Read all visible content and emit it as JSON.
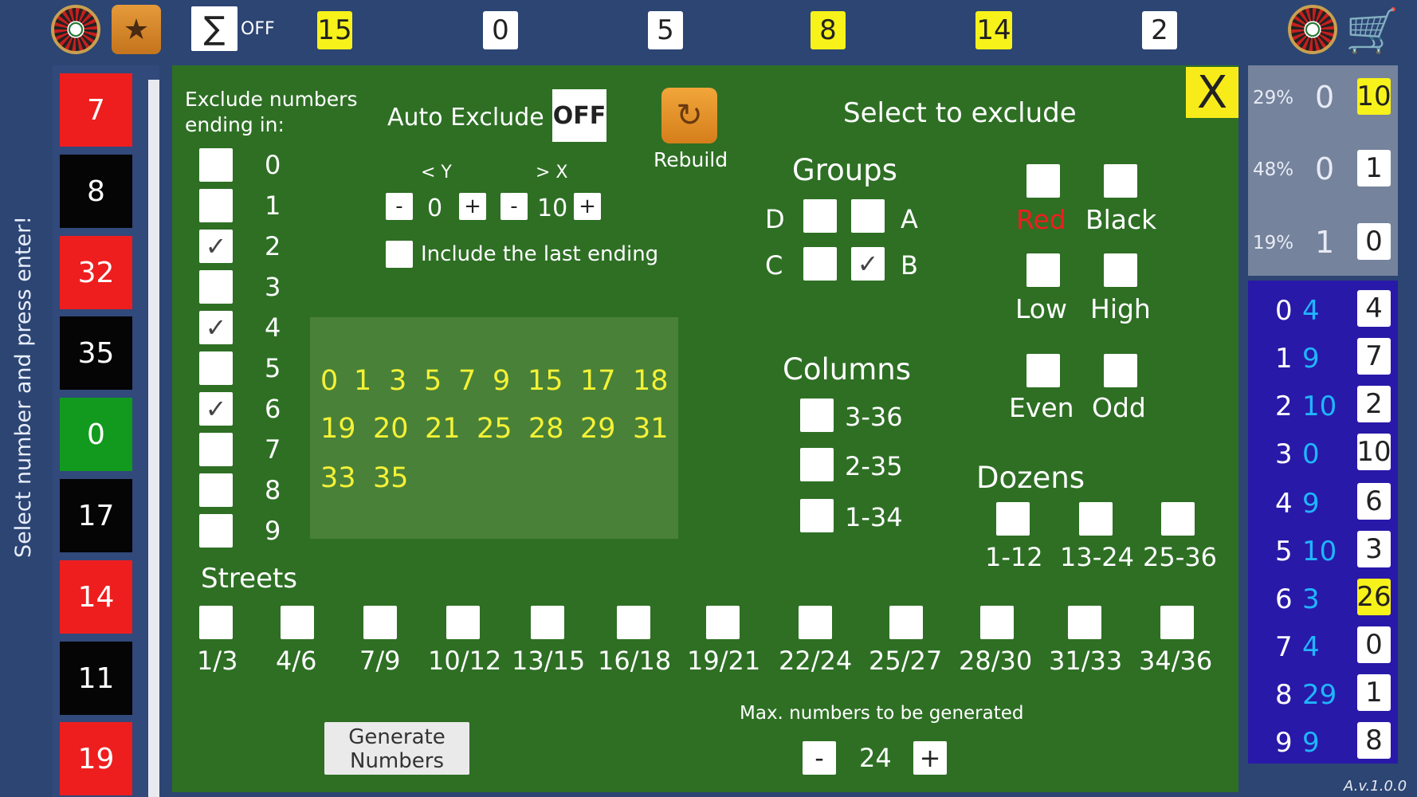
{
  "topbar": {
    "sigma_state": "OFF",
    "numbers": [
      {
        "value": "15",
        "color": "yellow"
      },
      {
        "value": "0",
        "color": "white"
      },
      {
        "value": "5",
        "color": "white"
      },
      {
        "value": "8",
        "color": "yellow"
      },
      {
        "value": "14",
        "color": "yellow"
      },
      {
        "value": "2",
        "color": "white"
      }
    ]
  },
  "sidebar_label": "Select number and press enter!",
  "history": [
    {
      "value": "7",
      "color": "red"
    },
    {
      "value": "8",
      "color": "black"
    },
    {
      "value": "32",
      "color": "red"
    },
    {
      "value": "35",
      "color": "black"
    },
    {
      "value": "0",
      "color": "green"
    },
    {
      "value": "17",
      "color": "black"
    },
    {
      "value": "14",
      "color": "red"
    },
    {
      "value": "11",
      "color": "black"
    },
    {
      "value": "19",
      "color": "red"
    }
  ],
  "panel": {
    "exclude_endings_title_1": "Exclude numbers",
    "exclude_endings_title_2": "ending in:",
    "endings": [
      {
        "digit": "0",
        "checked": false
      },
      {
        "digit": "1",
        "checked": false
      },
      {
        "digit": "2",
        "checked": true
      },
      {
        "digit": "3",
        "checked": false
      },
      {
        "digit": "4",
        "checked": true
      },
      {
        "digit": "5",
        "checked": false
      },
      {
        "digit": "6",
        "checked": true
      },
      {
        "digit": "7",
        "checked": false
      },
      {
        "digit": "8",
        "checked": false
      },
      {
        "digit": "9",
        "checked": false
      }
    ],
    "auto_exclude_label": "Auto Exclude",
    "auto_exclude_state": "OFF",
    "y_label": "< Y",
    "x_label": "> X",
    "y_value": "0",
    "x_value": "10",
    "minus": "-",
    "plus": "+",
    "include_last_label": "Include the last ending",
    "rebuild_label": "Rebuild",
    "select_title": "Select to exclude",
    "groups_title": "Groups",
    "groups": {
      "D": "D",
      "A": "A",
      "C": "C",
      "B": "B"
    },
    "group_b_checked": true,
    "columns_title": "Columns",
    "columns": [
      "3-36",
      "2-35",
      "1-34"
    ],
    "red_label": "Red",
    "black_label": "Black",
    "low_label": "Low",
    "high_label": "High",
    "even_label": "Even",
    "odd_label": "Odd",
    "dozens_title": "Dozens",
    "dozens": [
      "1-12",
      "13-24",
      "25-36"
    ],
    "streets_title": "Streets",
    "streets": [
      "1/3",
      "4/6",
      "7/9",
      "10/12",
      "13/15",
      "16/18",
      "19/21",
      "22/24",
      "25/27",
      "28/30",
      "31/33",
      "34/36"
    ],
    "generated_numbers": [
      "0",
      "1",
      "3",
      "5",
      "7",
      "9",
      "15",
      "17",
      "18",
      "19",
      "20",
      "21",
      "25",
      "28",
      "29",
      "31",
      "33",
      "35"
    ],
    "max_label": "Max. numbers to be generated",
    "max_value": "24",
    "generate_line1": "Generate",
    "generate_line2": "Numbers",
    "close": "X"
  },
  "stats_top": [
    {
      "pct": "29%",
      "mid": "0",
      "box": "10",
      "box_color": "yellow"
    },
    {
      "pct": "48%",
      "mid": "0",
      "box": "1",
      "box_color": "white"
    },
    {
      "pct": "19%",
      "mid": "1",
      "box": "0",
      "box_color": "white"
    }
  ],
  "stats_bottom": [
    {
      "digit": "0",
      "count": "4",
      "box": "4",
      "box_color": "white"
    },
    {
      "digit": "1",
      "count": "9",
      "box": "7",
      "box_color": "white"
    },
    {
      "digit": "2",
      "count": "10",
      "box": "2",
      "box_color": "white"
    },
    {
      "digit": "3",
      "count": "0",
      "box": "10",
      "box_color": "white"
    },
    {
      "digit": "4",
      "count": "9",
      "box": "6",
      "box_color": "white"
    },
    {
      "digit": "5",
      "count": "10",
      "box": "3",
      "box_color": "white"
    },
    {
      "digit": "6",
      "count": "3",
      "box": "26",
      "box_color": "yellow"
    },
    {
      "digit": "7",
      "count": "4",
      "box": "0",
      "box_color": "white"
    },
    {
      "digit": "8",
      "count": "29",
      "box": "1",
      "box_color": "white"
    },
    {
      "digit": "9",
      "count": "9",
      "box": "8",
      "box_color": "white"
    }
  ],
  "version": "A.v.1.0.0",
  "colors": {
    "panel_green": "#2e6f24",
    "accent_yellow": "#f4f236",
    "red": "#ee1e1e",
    "stats_blue": "#2919a8",
    "count_cyan": "#1fb6ff"
  }
}
